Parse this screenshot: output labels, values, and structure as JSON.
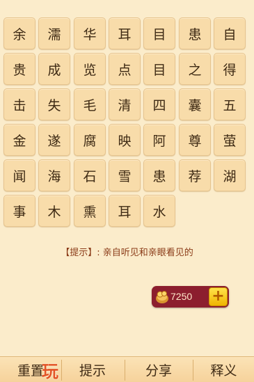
{
  "grid": {
    "rows": [
      [
        "余",
        "濡",
        "华",
        "耳",
        "目",
        "患",
        "自"
      ],
      [
        "贵",
        "成",
        "览",
        "点",
        "目",
        "之",
        "得"
      ],
      [
        "击",
        "失",
        "毛",
        "清",
        "四",
        "囊",
        "五"
      ],
      [
        "金",
        "遂",
        "腐",
        "映",
        "阿",
        "尊",
        "萤"
      ],
      [
        "闻",
        "海",
        "石",
        "雪",
        "患",
        "荐",
        "湖"
      ],
      [
        "事",
        "木",
        "熏",
        "耳",
        "水"
      ]
    ]
  },
  "hint": {
    "tag": "【提示】:",
    "text": "亲自听见和亲眼看见的"
  },
  "coins": {
    "count": "7250",
    "plus_label": "+"
  },
  "bottom_bar": {
    "reset": "重置",
    "hint": "提示",
    "share": "分享",
    "explain": "释义"
  },
  "watermark": {
    "logo_char": "玩"
  },
  "colors": {
    "background": "#fbeccb",
    "tile": "#f8dcaa",
    "hint_text": "#8a3a17",
    "coin_box": "#8c1e2e",
    "plus_button": "#f0b400"
  }
}
